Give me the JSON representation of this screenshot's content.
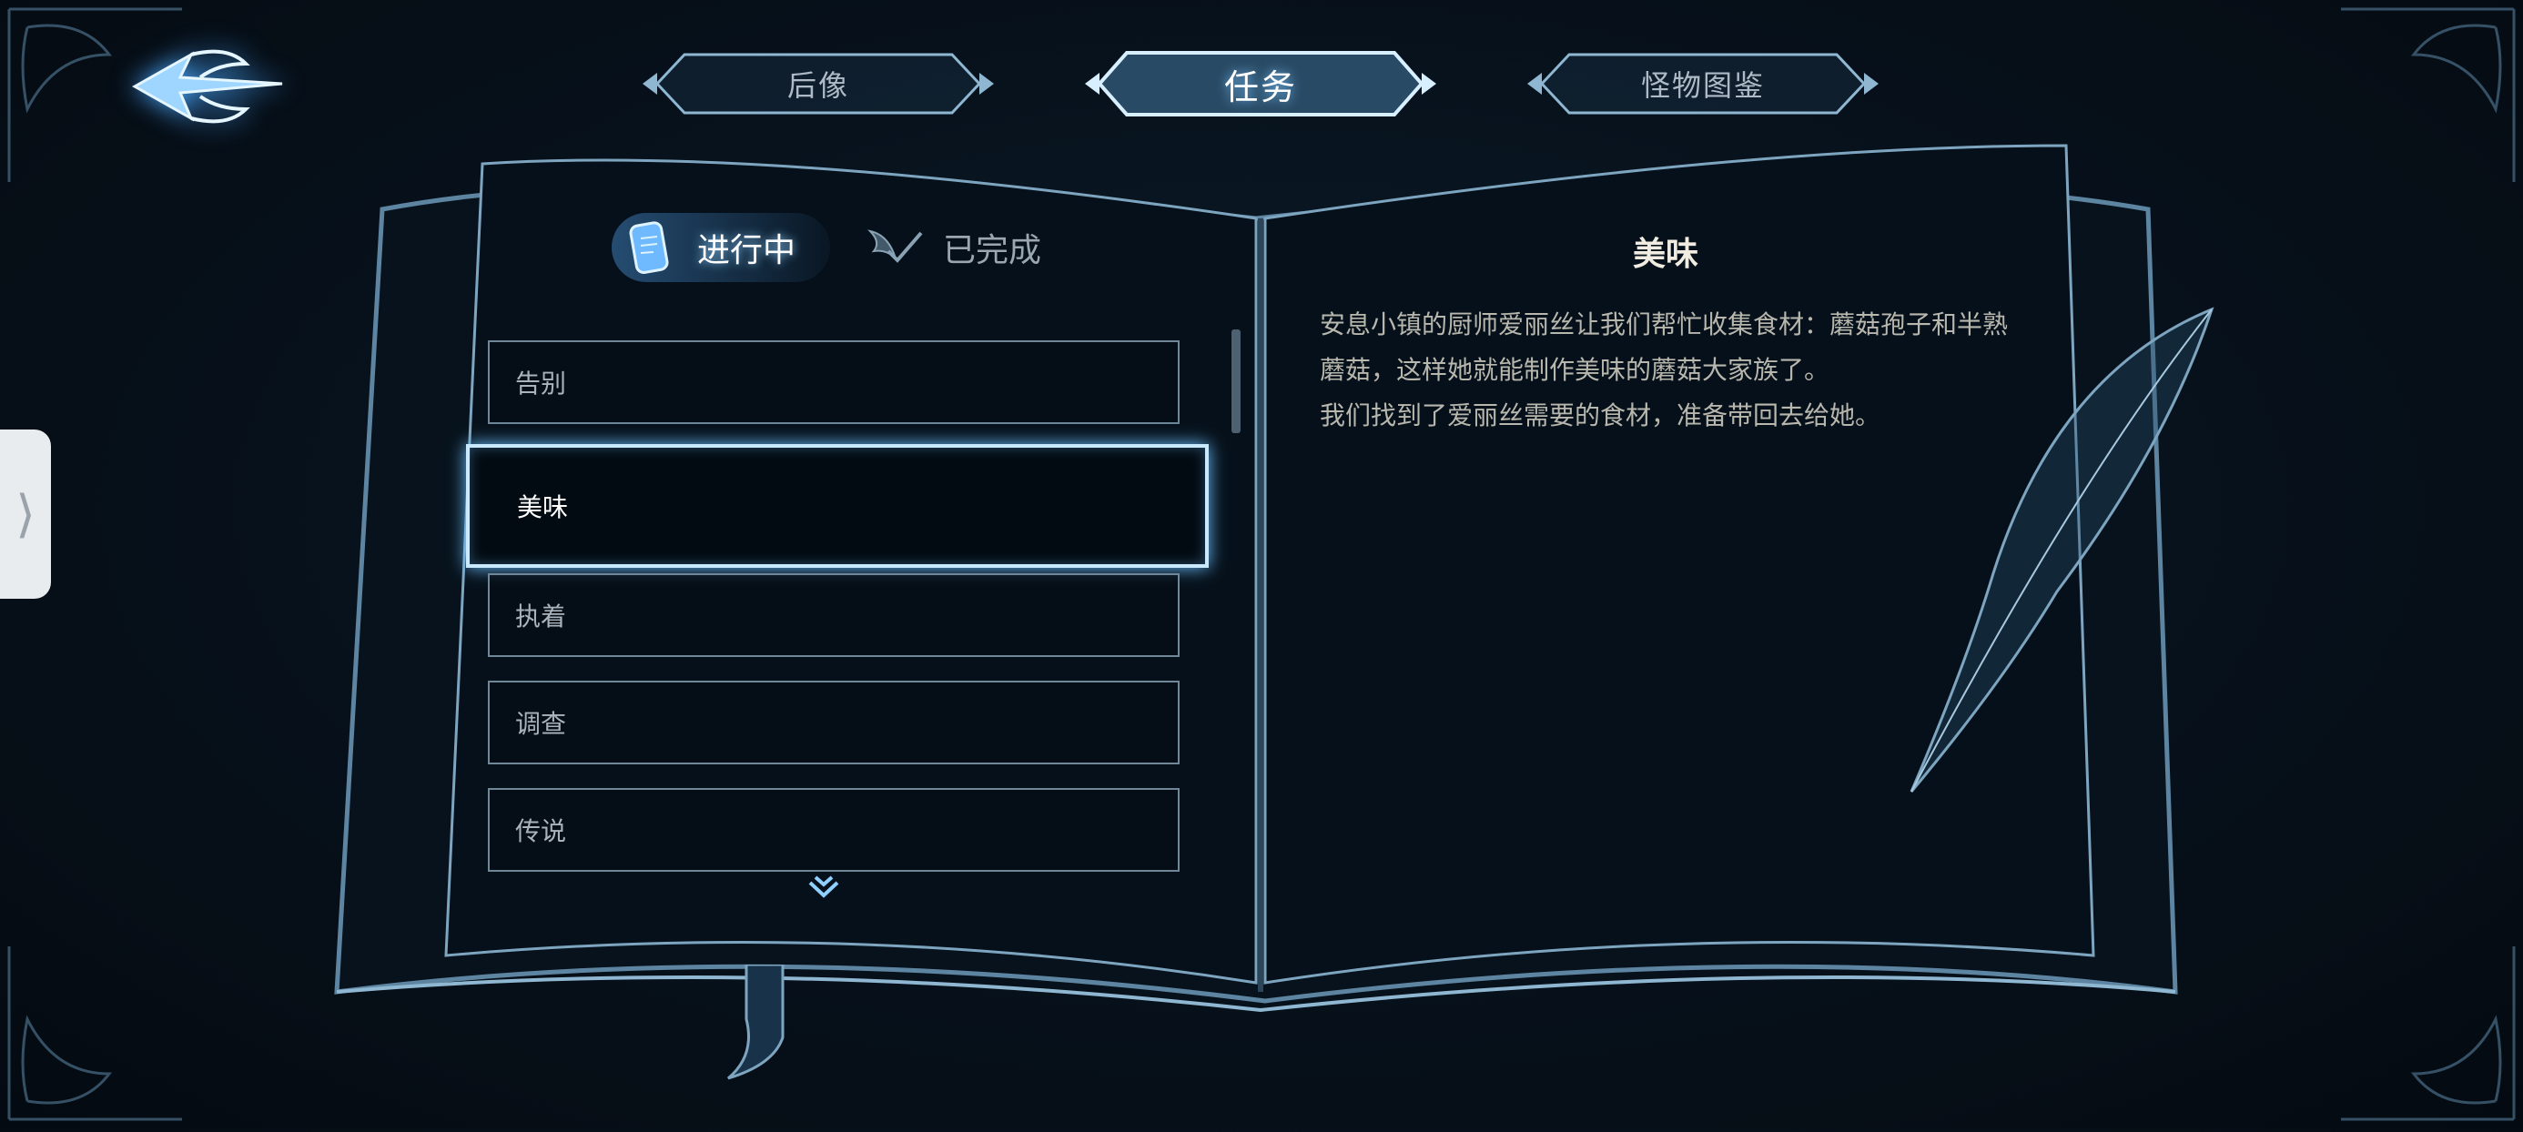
{
  "nav": {
    "back_icon": "winged-arrow-back-icon",
    "tabs": [
      {
        "label": "后像",
        "active": false
      },
      {
        "label": "任务",
        "active": true
      },
      {
        "label": "怪物图鉴",
        "active": false
      }
    ]
  },
  "side_handle": {
    "glyph": "⟩"
  },
  "quest_status_tabs": [
    {
      "label": "进行中",
      "icon": "scroll-icon",
      "active": true
    },
    {
      "label": "已完成",
      "icon": "wings-check-icon",
      "active": false
    }
  ],
  "quests": [
    {
      "label": "告别"
    },
    {
      "label": "美味",
      "selected": true
    },
    {
      "label": "执着"
    },
    {
      "label": "调查"
    },
    {
      "label": "传说"
    }
  ],
  "detail": {
    "title": "美味",
    "line1": "安息小镇的厨师爱丽丝让我们帮忙收集食材：蘑菇孢子和半熟",
    "line2": "蘑菇，这样她就能制作美味的蘑菇大家族了。",
    "line3": "我们找到了爱丽丝需要的食材，准备带回去给她。"
  },
  "colors": {
    "background": "#07111b",
    "glow": "#6cc0ff",
    "selected_border": "#c8e9ff",
    "title_text": "#f1ece2"
  }
}
